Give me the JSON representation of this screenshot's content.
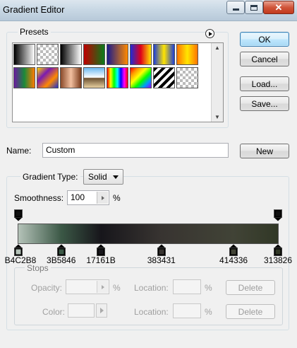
{
  "window": {
    "title": "Gradient Editor"
  },
  "buttons": {
    "ok": "OK",
    "cancel": "Cancel",
    "load": "Load...",
    "save": "Save...",
    "new": "New",
    "delete": "Delete"
  },
  "presets": {
    "label": "Presets",
    "swatches": [
      {
        "name": "foreground-to-background",
        "css": "linear-gradient(to right, #000, #fff)"
      },
      {
        "name": "foreground-to-transparent",
        "css": "linear-gradient(to right, #000, rgba(0,0,0,0))"
      },
      {
        "name": "black-white",
        "css": "linear-gradient(to right, #000, #fff)"
      },
      {
        "name": "red-green",
        "css": "linear-gradient(to right, #c00000, #0a7a1a)"
      },
      {
        "name": "violet-orange",
        "css": "linear-gradient(to right, #1a1a8c, #ff8a00)"
      },
      {
        "name": "blue-red-yellow",
        "css": "linear-gradient(to right, #1f2bd6, #e0001a, #ffe600)"
      },
      {
        "name": "blue-yellow-blue",
        "css": "linear-gradient(to right, #1c3dd8, #ffe400, #1c3dd8)"
      },
      {
        "name": "orange-yellow-orange",
        "css": "linear-gradient(to right, #ff7400, #ffe600, #ff7400)"
      },
      {
        "name": "violet-green-orange",
        "css": "linear-gradient(to right, #6a1aa0, #1a8a3a, #ff7a00)"
      },
      {
        "name": "yellow-violet-orange-blue",
        "css": "linear-gradient(135deg, #ffd800, #7a1ab0, #ff8a00, #2030d0)"
      },
      {
        "name": "copper",
        "css": "linear-gradient(to right, #8a4a2a, #f2c0a0, #7a3a1a)"
      },
      {
        "name": "chrome",
        "css": "linear-gradient(to bottom, #6ab8f0 0%, #ffffff 48%, #6a5030 52%, #e8d0a0 100%)"
      },
      {
        "name": "spectrum",
        "css": "linear-gradient(to right, #ff0000, #ffff00, #00ff00, #00ffff, #0000ff, #ff00ff, #ff0000)"
      },
      {
        "name": "transparent-rainbow",
        "css": "linear-gradient(135deg, #ff0000, #ff9900, #ffff00, #00ff00, #0099ff, #9900ff)"
      },
      {
        "name": "transparent-stripes",
        "css": "repeating-linear-gradient(135deg, #000 0px, #000 4px, #fff 4px, #fff 8px)"
      },
      {
        "name": "transparent-checker",
        "css": "checker"
      }
    ]
  },
  "name_field": {
    "label": "Name:",
    "value": "Custom"
  },
  "gradient_type": {
    "label": "Gradient Type:",
    "value": "Solid"
  },
  "smoothness": {
    "label": "Smoothness:",
    "value": "100",
    "unit": "%"
  },
  "gradient": {
    "opacity_stops": [
      {
        "position": 0
      },
      {
        "position": 1
      }
    ],
    "color_stops": [
      {
        "hex": "B4C2B8",
        "label": "B4C2B8",
        "position": 0.0
      },
      {
        "hex": "3B5846",
        "label": "3B5846",
        "position": 0.165
      },
      {
        "hex": "17161B",
        "label": "17161B",
        "position": 0.318
      },
      {
        "hex": "383431",
        "label": "383431",
        "position": 0.551
      },
      {
        "hex": "414336",
        "label": "414336",
        "position": 0.829
      },
      {
        "hex": "313826",
        "label": "313826",
        "position": 1.0
      }
    ]
  },
  "stops": {
    "label": "Stops",
    "opacity_label": "Opacity:",
    "opacity_unit": "%",
    "location_label": "Location:",
    "location_unit": "%",
    "color_label": "Color:"
  }
}
